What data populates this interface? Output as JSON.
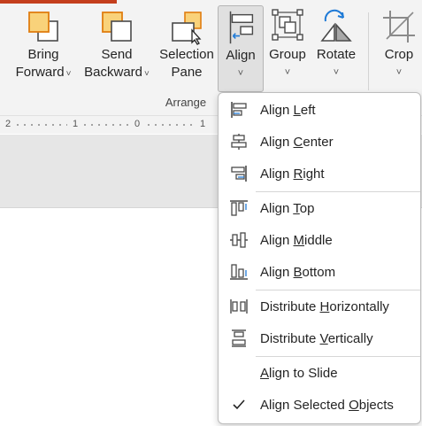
{
  "ribbon": {
    "bring_forward": {
      "line1": "Bring",
      "line2": "Forward",
      "chevron": "˅"
    },
    "send_backward": {
      "line1": "Send",
      "line2": "Backward",
      "chevron": "˅"
    },
    "selection_pane": {
      "line1": "Selection",
      "line2": "Pane"
    },
    "align": {
      "label": "Align",
      "chevron": "˅"
    },
    "group": {
      "label": "Group",
      "chevron": "˅"
    },
    "rotate": {
      "label": "Rotate",
      "chevron": "˅"
    },
    "crop": {
      "label": "Crop",
      "chevron": "˅"
    },
    "group_label": "Arrange"
  },
  "ruler": {
    "labels": [
      "2",
      "1",
      "0",
      "1"
    ]
  },
  "menu": {
    "items": [
      {
        "pre": "Align ",
        "key": "L",
        "post": "eft",
        "icon": "align-left-icon"
      },
      {
        "pre": "Align ",
        "key": "C",
        "post": "enter",
        "icon": "align-center-icon"
      },
      {
        "pre": "Align ",
        "key": "R",
        "post": "ight",
        "icon": "align-right-icon"
      },
      {
        "pre": "Align ",
        "key": "T",
        "post": "op",
        "icon": "align-top-icon"
      },
      {
        "pre": "Align ",
        "key": "M",
        "post": "iddle",
        "icon": "align-middle-icon"
      },
      {
        "pre": "Align ",
        "key": "B",
        "post": "ottom",
        "icon": "align-bottom-icon"
      },
      {
        "pre": "Distribute ",
        "key": "H",
        "post": "orizontally",
        "icon": "distribute-horizontally-icon"
      },
      {
        "pre": "Distribute ",
        "key": "V",
        "post": "ertically",
        "icon": "distribute-vertically-icon"
      },
      {
        "pre": "",
        "key": "A",
        "post": "lign to Slide",
        "icon": ""
      },
      {
        "pre": "Align Selected ",
        "key": "O",
        "post": "bjects",
        "icon": "checkmark-icon"
      }
    ]
  },
  "colors": {
    "accent": "#c43e1c",
    "shape_fill": "#f9d27a",
    "shape_stroke": "#e07d10",
    "icon_blue": "#1f7ad6",
    "icon_gray": "#4a4a4a"
  }
}
